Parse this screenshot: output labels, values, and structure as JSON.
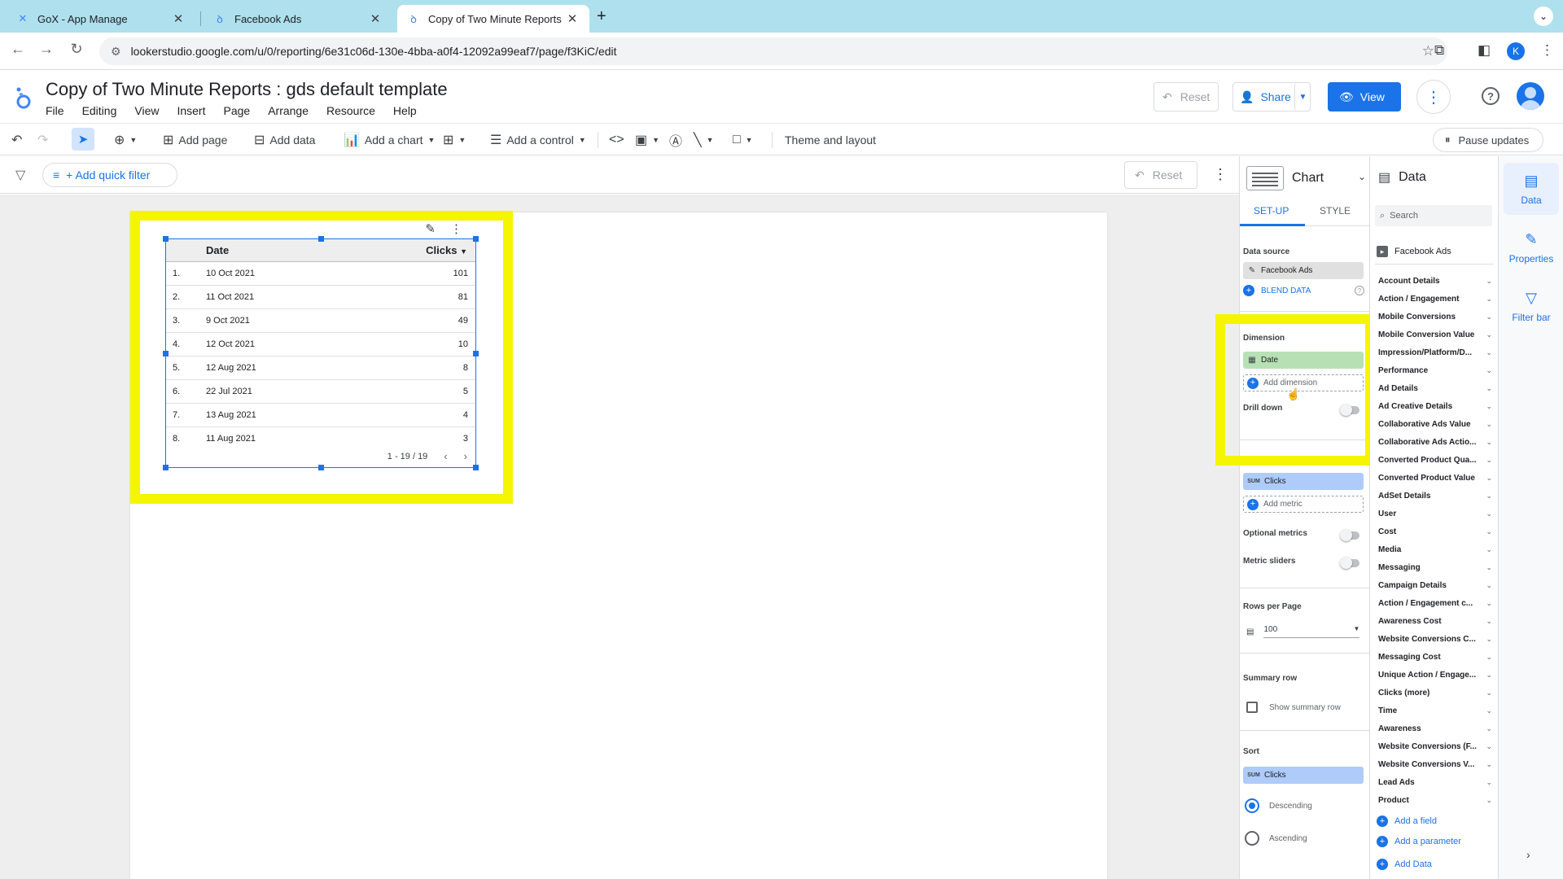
{
  "browser": {
    "tabs": [
      {
        "title": "GoX - App Manage",
        "icon": "gox-favicon"
      },
      {
        "title": "Facebook Ads",
        "icon": "looker-studio-favicon"
      },
      {
        "title": "Copy of Two Minute Reports",
        "icon": "looker-studio-favicon"
      }
    ],
    "url": "lookerstudio.google.com/u/0/reporting/6e31c06d-130e-4bba-a0f4-12092a99eaf7/page/f3KiC/edit",
    "profile_initial": "K"
  },
  "app": {
    "title": "Copy of Two Minute Reports : gds default template",
    "menu": [
      "File",
      "Editing",
      "View",
      "Insert",
      "Page",
      "Arrange",
      "Resource",
      "Help"
    ],
    "reset_label": "Reset",
    "share_label": "Share",
    "view_label": "View"
  },
  "toolbar": {
    "add_page": "Add page",
    "add_data": "Add data",
    "add_chart": "Add a chart",
    "add_control": "Add a control",
    "theme_layout": "Theme and layout",
    "pause_updates": "Pause updates"
  },
  "filterbar": {
    "quick_filter": "+ Add quick filter",
    "reset_label": "Reset"
  },
  "table": {
    "headers": {
      "dimension": "Date",
      "metric": "Clicks"
    },
    "rows": [
      {
        "n": "1.",
        "date": "10 Oct 2021",
        "clicks": "101"
      },
      {
        "n": "2.",
        "date": "11 Oct 2021",
        "clicks": "81"
      },
      {
        "n": "3.",
        "date": "9 Oct 2021",
        "clicks": "49"
      },
      {
        "n": "4.",
        "date": "12 Oct 2021",
        "clicks": "10"
      },
      {
        "n": "5.",
        "date": "12 Aug 2021",
        "clicks": "8"
      },
      {
        "n": "6.",
        "date": "22 Jul 2021",
        "clicks": "5"
      },
      {
        "n": "7.",
        "date": "13 Aug 2021",
        "clicks": "4"
      },
      {
        "n": "8.",
        "date": "11 Aug 2021",
        "clicks": "3"
      }
    ],
    "pagination": "1 - 19 / 19"
  },
  "properties": {
    "panel_title": "Chart",
    "tabs": [
      "SET-UP",
      "STYLE"
    ],
    "data_source_label": "Data source",
    "data_source": "Facebook Ads",
    "blend_data": "BLEND DATA",
    "dimension_label": "Dimension",
    "dimension": "Date",
    "add_dimension": "Add dimension",
    "drill_down": "Drill down",
    "metric_agg": "SUM",
    "metric": "Clicks",
    "add_metric": "Add metric",
    "optional_metrics": "Optional metrics",
    "metric_sliders": "Metric sliders",
    "rows_per_page_label": "Rows per Page",
    "rows_per_page": "100",
    "summary_row_label": "Summary row",
    "show_summary_row": "Show summary row",
    "sort_label": "Sort",
    "sort_agg": "SUM",
    "sort_field": "Clicks",
    "descending": "Descending",
    "ascending": "Ascending"
  },
  "data_panel": {
    "title": "Data",
    "search_placeholder": "Search",
    "source": "Facebook Ads",
    "groups": [
      "Account Details",
      "Action / Engagement",
      "Mobile Conversions",
      "Mobile Conversion Value",
      "Impression/Platform/D...",
      "Performance",
      "Ad Details",
      "Ad Creative Details",
      "Collaborative Ads Value",
      "Collaborative Ads Actio...",
      "Converted Product Qua...",
      "Converted Product Value",
      "AdSet Details",
      "User",
      "Cost",
      "Media",
      "Messaging",
      "Campaign Details",
      "Action / Engagement c...",
      "Awareness Cost",
      "Website Conversions C...",
      "Messaging Cost",
      "Unique Action / Engage...",
      "Clicks (more)",
      "Time",
      "Awareness",
      "Website Conversions (F...",
      "Website Conversions V...",
      "Lead Ads",
      "Product"
    ],
    "add_field": "Add a field",
    "add_parameter": "Add a parameter",
    "add_data": "Add Data"
  },
  "rail": {
    "data": "Data",
    "properties": "Properties",
    "filter_bar": "Filter bar"
  }
}
